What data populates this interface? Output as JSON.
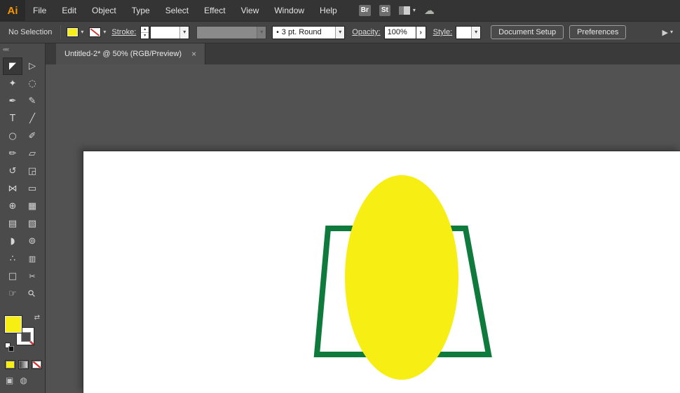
{
  "menubar": {
    "logo": "Ai",
    "items": [
      "File",
      "Edit",
      "Object",
      "Type",
      "Select",
      "Effect",
      "View",
      "Window",
      "Help"
    ],
    "bridge": "Br",
    "stock": "St"
  },
  "control_bar": {
    "selection_status": "No Selection",
    "stroke_label": "Stroke:",
    "stroke_weight_value": "",
    "width_profile_value": "",
    "brush_name": "3 pt. Round",
    "opacity_label": "Opacity:",
    "opacity_value": "100%",
    "style_label": "Style:",
    "style_value": "",
    "document_setup_button": "Document Setup",
    "preferences_button": "Preferences"
  },
  "tabbar": {
    "title": "Untitled-2* @ 50% (RGB/Preview)",
    "close_icon": "×"
  },
  "toolbar": {
    "collapse_icon": "««",
    "tools": [
      {
        "name": "selection",
        "glyph": "◤",
        "selected": true
      },
      {
        "name": "direct-selection",
        "glyph": "▷"
      },
      {
        "name": "magic-wand",
        "glyph": "✦"
      },
      {
        "name": "lasso",
        "glyph": "◌"
      },
      {
        "name": "pen",
        "glyph": "✒"
      },
      {
        "name": "curvature",
        "glyph": "✎"
      },
      {
        "name": "type",
        "glyph": "T"
      },
      {
        "name": "line-segment",
        "glyph": "╱"
      },
      {
        "name": "ellipse",
        "glyph": "○"
      },
      {
        "name": "paintbrush",
        "glyph": "✐"
      },
      {
        "name": "pencil",
        "glyph": "✏"
      },
      {
        "name": "eraser",
        "glyph": "▱"
      },
      {
        "name": "rotate",
        "glyph": "↺"
      },
      {
        "name": "scale",
        "glyph": "◲"
      },
      {
        "name": "width",
        "glyph": "⋈"
      },
      {
        "name": "free-transform",
        "glyph": "▭"
      },
      {
        "name": "shape-builder",
        "glyph": "⊕"
      },
      {
        "name": "perspective-grid",
        "glyph": "▦"
      },
      {
        "name": "mesh",
        "glyph": "▤"
      },
      {
        "name": "gradient",
        "glyph": "▧"
      },
      {
        "name": "eyedropper",
        "glyph": "◗"
      },
      {
        "name": "blend",
        "glyph": "⊚"
      },
      {
        "name": "symbol-sprayer",
        "glyph": "∴"
      },
      {
        "name": "column-graph",
        "glyph": "▥"
      },
      {
        "name": "artboard",
        "glyph": "□"
      },
      {
        "name": "slice",
        "glyph": "✂"
      },
      {
        "name": "hand",
        "glyph": "☞"
      },
      {
        "name": "zoom",
        "glyph": "⚲"
      }
    ]
  },
  "icons": {
    "caret_down": "▾",
    "caret_up": "▴",
    "chevron_right": "›",
    "swap_icon": "⇄",
    "pointer": "▶",
    "cloud": "☁",
    "brush_dot": "•",
    "screen_mode": "▣",
    "draw_mode": "◍"
  },
  "colors": {
    "fill_yellow": "#f7ee14",
    "trapezoid_green": "#0e7b3d",
    "stroke_none_red": "#d5322d",
    "logo_orange": "#f79500"
  }
}
